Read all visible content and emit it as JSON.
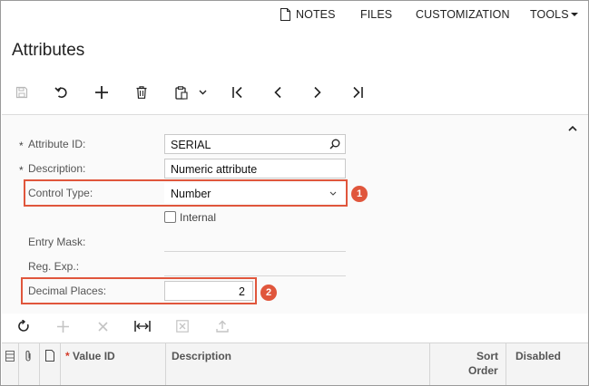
{
  "topmenu": {
    "notes": "NOTES",
    "files": "FILES",
    "customization": "CUSTOMIZATION",
    "tools": "TOOLS"
  },
  "page_title": "Attributes",
  "form": {
    "attribute_id": {
      "label": "Attribute ID:",
      "value": "SERIAL",
      "required_mark": "*"
    },
    "description": {
      "label": "Description:",
      "value": "Numeric attribute",
      "required_mark": "*"
    },
    "control_type": {
      "label": "Control Type:",
      "value": "Number"
    },
    "internal": {
      "label": "Internal",
      "checked": false
    },
    "entry_mask": {
      "label": "Entry Mask:",
      "value": ""
    },
    "reg_exp": {
      "label": "Reg. Exp.:",
      "value": ""
    },
    "decimal_places": {
      "label": "Decimal Places:",
      "value": "2"
    }
  },
  "callouts": [
    "1",
    "2"
  ],
  "grid": {
    "columns": {
      "value_id": "Value ID",
      "value_id_required": "*",
      "description": "Description",
      "sort_order_1": "Sort",
      "sort_order_2": "Order",
      "disabled": "Disabled"
    }
  },
  "colors": {
    "highlight": "#e0563c",
    "panel_bg": "#fafafa",
    "grid_header_bg": "#f4f4f4"
  }
}
